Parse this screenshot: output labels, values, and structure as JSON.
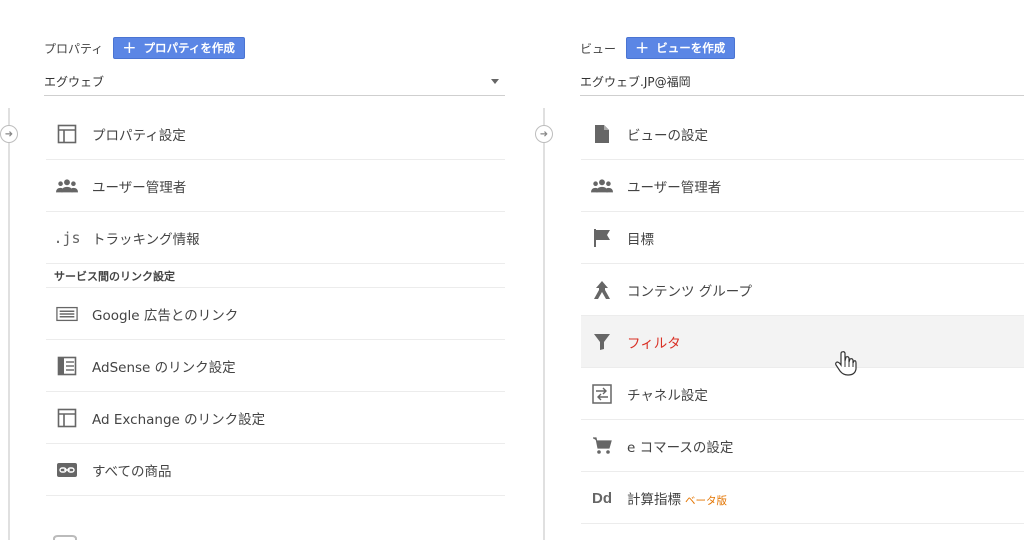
{
  "property": {
    "header_label": "プロパティ",
    "create_button": "プロパティを作成",
    "selected": "エグウェブ",
    "items": [
      {
        "label": "プロパティ設定",
        "icon": "property-settings-icon"
      },
      {
        "label": "ユーザー管理者",
        "icon": "users-icon"
      },
      {
        "label": "トラッキング情報",
        "icon": "js-icon"
      }
    ],
    "section_title": "サービス間のリンク設定",
    "link_items": [
      {
        "label": "Google 広告とのリンク",
        "icon": "google-ads-icon"
      },
      {
        "label": "AdSense のリンク設定",
        "icon": "adsense-icon"
      },
      {
        "label": "Ad Exchange のリンク設定",
        "icon": "ad-exchange-icon"
      },
      {
        "label": "すべての商品",
        "icon": "link-icon"
      }
    ]
  },
  "view": {
    "header_label": "ビュー",
    "create_button": "ビューを作成",
    "selected": "エグウェブ.JP@福岡",
    "items": [
      {
        "label": "ビューの設定",
        "icon": "document-icon"
      },
      {
        "label": "ユーザー管理者",
        "icon": "users-icon"
      },
      {
        "label": "目標",
        "icon": "flag-icon"
      },
      {
        "label": "コンテンツ グループ",
        "icon": "content-grouping-icon"
      },
      {
        "label": "フィルタ",
        "icon": "filter-icon",
        "active": true
      },
      {
        "label": "チャネル設定",
        "icon": "channel-settings-icon"
      },
      {
        "label": "e コマースの設定",
        "icon": "cart-icon"
      },
      {
        "label": "計算指標",
        "badge": "ベータ版",
        "icon": "dd-icon"
      }
    ]
  },
  "icons": {
    "plus": "+",
    "collapse": "➜",
    "js": ".js",
    "dd": "Dd"
  },
  "colors": {
    "accent_button": "#5b86e5",
    "filter_label": "#d93025",
    "beta_badge": "#e37400",
    "icon_gray": "#666666"
  }
}
